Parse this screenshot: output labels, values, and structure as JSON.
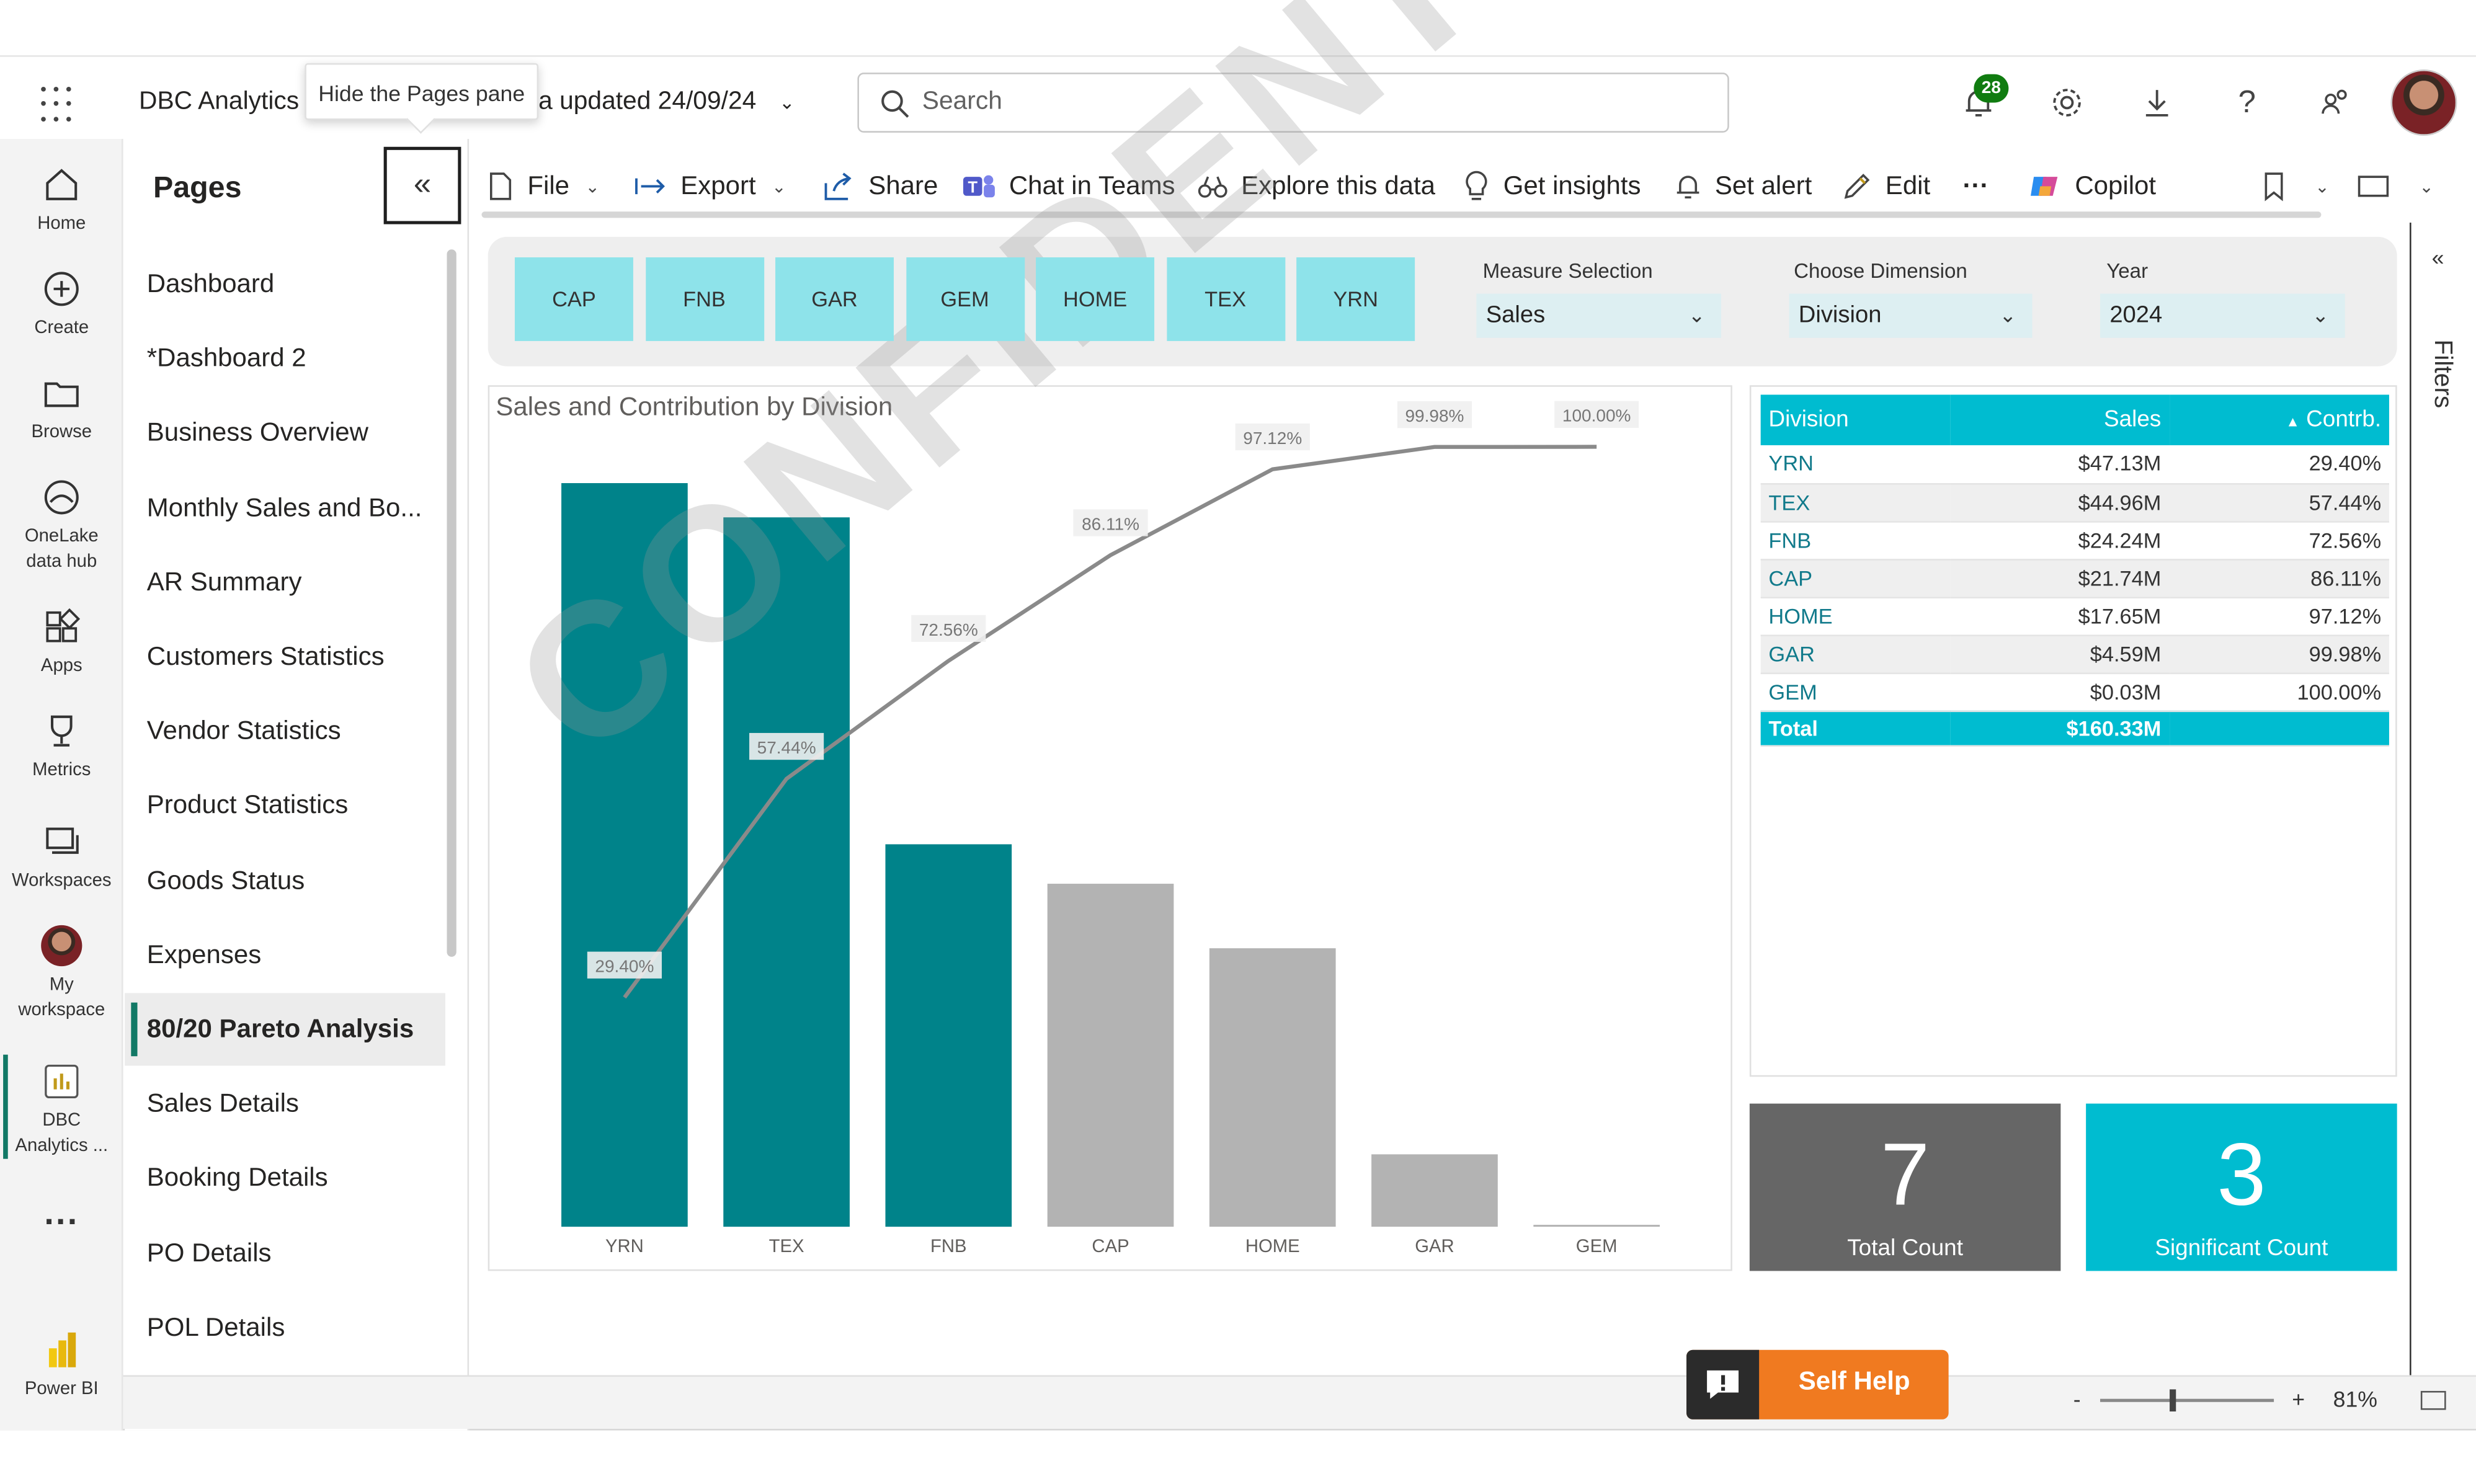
{
  "app": {
    "title": "DBC Analytics",
    "updated": "a updated 24/09/24",
    "tooltip": "Hide the Pages pane"
  },
  "search": {
    "placeholder": "Search"
  },
  "notifications": {
    "count": "28"
  },
  "nav": {
    "items": [
      "Home",
      "Create",
      "Browse",
      "OneLake data hub",
      "Apps",
      "Metrics",
      "Workspaces",
      "My workspace",
      "DBC Analytics ...",
      "Power BI"
    ]
  },
  "pages": {
    "title": "Pages",
    "items": [
      "Dashboard",
      "*Dashboard 2",
      "Business Overview",
      "Monthly Sales and Bo...",
      "AR Summary",
      "Customers Statistics",
      "Vendor Statistics",
      "Product Statistics",
      "Goods Status",
      "Expenses",
      "80/20 Pareto Analysis",
      "Sales Details",
      "Booking Details",
      "PO Details",
      "POL Details"
    ],
    "active_index": 10
  },
  "toolbar": {
    "file": "File",
    "export": "Export",
    "share": "Share",
    "chat": "Chat in Teams",
    "explore": "Explore this data",
    "insights": "Get insights",
    "alert": "Set alert",
    "edit": "Edit",
    "more": "···",
    "copilot": "Copilot"
  },
  "slicer": {
    "tiles": [
      "CAP",
      "FNB",
      "GAR",
      "GEM",
      "HOME",
      "TEX",
      "YRN"
    ],
    "measure_label": "Measure Selection",
    "measure_value": "Sales",
    "dimension_label": "Choose Dimension",
    "dimension_value": "Division",
    "year_label": "Year",
    "year_value": "2024"
  },
  "chart_data": {
    "type": "bar",
    "title": "Sales and Contribution by Division",
    "categories": [
      "YRN",
      "TEX",
      "FNB",
      "CAP",
      "HOME",
      "GAR",
      "GEM"
    ],
    "series": [
      {
        "name": "Sales",
        "values": [
          47.13,
          44.96,
          24.24,
          21.74,
          17.65,
          4.59,
          0.03
        ]
      },
      {
        "name": "Contribution",
        "values": [
          29.4,
          57.44,
          72.56,
          86.11,
          97.12,
          99.98,
          100.0
        ]
      }
    ],
    "labels": [
      "29.40%",
      "57.44%",
      "72.56%",
      "86.11%",
      "97.12%",
      "99.98%",
      "100.00%"
    ],
    "significant": [
      true,
      true,
      true,
      false,
      false,
      false,
      false
    ],
    "colors": {
      "significant": "#00838a",
      "other": "#b3b3b3",
      "line": "#8a8a8a"
    }
  },
  "table": {
    "headers": [
      "Division",
      "Sales",
      "Contrb."
    ],
    "rows": [
      [
        "YRN",
        "$47.13M",
        "29.40%"
      ],
      [
        "TEX",
        "$44.96M",
        "57.44%"
      ],
      [
        "FNB",
        "$24.24M",
        "72.56%"
      ],
      [
        "CAP",
        "$21.74M",
        "86.11%"
      ],
      [
        "HOME",
        "$17.65M",
        "97.12%"
      ],
      [
        "GAR",
        "$4.59M",
        "99.98%"
      ],
      [
        "GEM",
        "$0.03M",
        "100.00%"
      ]
    ],
    "total": [
      "Total",
      "$160.33M",
      ""
    ]
  },
  "cards": {
    "total_value": "7",
    "total_label": "Total Count",
    "sig_value": "3",
    "sig_label": "Significant Count"
  },
  "filters": {
    "label": "Filters"
  },
  "selfhelp": {
    "label": "Self Help"
  },
  "zoom": {
    "level": "81%"
  },
  "watermark": "CONFIDENTIAL"
}
